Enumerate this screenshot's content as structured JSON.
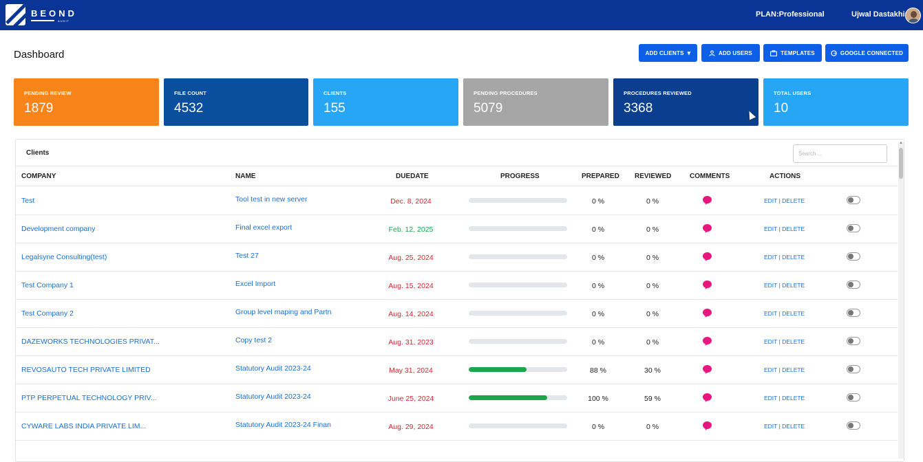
{
  "header": {
    "brand": "BEOND",
    "brand_sub": "AUDIT",
    "plan": "PLAN:Professional",
    "user_name": "Ujwal Dastakhir"
  },
  "page": {
    "title": "Dashboard"
  },
  "toolbar": {
    "add_clients": "ADD CLIENTS",
    "add_users": "ADD USERS",
    "templates": "TEMPLATES",
    "google_connected": "GOOGLE CONNECTED"
  },
  "stats": [
    {
      "label": "PENDING REVIEW",
      "value": "1879",
      "color": "#f98419"
    },
    {
      "label": "FILE COUNT",
      "value": "4532",
      "color": "#0a4f9e"
    },
    {
      "label": "CLIENTS",
      "value": "155",
      "color": "#26a6f5"
    },
    {
      "label": "PENDING PROCEDURES",
      "value": "5079",
      "color": "#a6a6a6"
    },
    {
      "label": "PROCEDURES REVIEWED",
      "value": "3368",
      "color": "#0a3f8f"
    },
    {
      "label": "TOTAL USERS",
      "value": "10",
      "color": "#26a6f5"
    }
  ],
  "clients": {
    "title": "Clients",
    "search_placeholder": "Search ...",
    "columns": [
      "COMPANY",
      "NAME",
      "DUEDATE",
      "PROGRESS",
      "PREPARED",
      "REVIEWED",
      "COMMENTS",
      "ACTIONS"
    ],
    "edit_label": "EDIT",
    "delete_label": "DELETE",
    "rows": [
      {
        "company": "Test",
        "name": "Tool test in new server",
        "due": "Dec. 8, 2024",
        "due_status": "overdue",
        "progress": 0,
        "prepared": "0 %",
        "reviewed": "0 %"
      },
      {
        "company": "Development company",
        "name": "Final excel export",
        "due": "Feb. 12, 2025",
        "due_status": "upcoming",
        "progress": 0,
        "prepared": "0 %",
        "reviewed": "0 %"
      },
      {
        "company": "Legalsyne Consulting(test)",
        "name": "Test 27",
        "due": "Aug. 25, 2024",
        "due_status": "overdue",
        "progress": 0,
        "prepared": "0 %",
        "reviewed": "0 %"
      },
      {
        "company": "Test Company 1",
        "name": "Excel Import",
        "due": "Aug. 15, 2024",
        "due_status": "overdue",
        "progress": 0,
        "prepared": "0 %",
        "reviewed": "0 %"
      },
      {
        "company": "Test Company 2",
        "name": "Group level maping and Partn",
        "due": "Aug. 14, 2024",
        "due_status": "overdue",
        "progress": 0,
        "prepared": "0 %",
        "reviewed": "0 %"
      },
      {
        "company": "DAZEWORKS TECHNOLOGIES PRIVAT...",
        "name": "Copy test 2",
        "due": "Aug. 31, 2023",
        "due_status": "overdue",
        "progress": 0,
        "prepared": "0 %",
        "reviewed": "0 %"
      },
      {
        "company": "REVOSAUTO TECH PRIVATE LIMITED",
        "name": "Statutory Audit 2023-24",
        "due": "May 31, 2024",
        "due_status": "overdue",
        "progress": 0.59,
        "prepared": "88 %",
        "reviewed": "30 %"
      },
      {
        "company": "PTP PERPETUAL TECHNOLOGY PRIV...",
        "name": "Statutory Audit 2023-24",
        "due": "June 25, 2024",
        "due_status": "overdue",
        "progress": 0.8,
        "prepared": "100 %",
        "reviewed": "59 %"
      },
      {
        "company": "CYWARE LABS INDIA PRIVATE LIM...",
        "name": "Statutory Audit 2023-24 Finan",
        "due": "Aug. 29, 2024",
        "due_status": "overdue",
        "progress": 0,
        "prepared": "0 %",
        "reviewed": "0 %"
      }
    ]
  }
}
